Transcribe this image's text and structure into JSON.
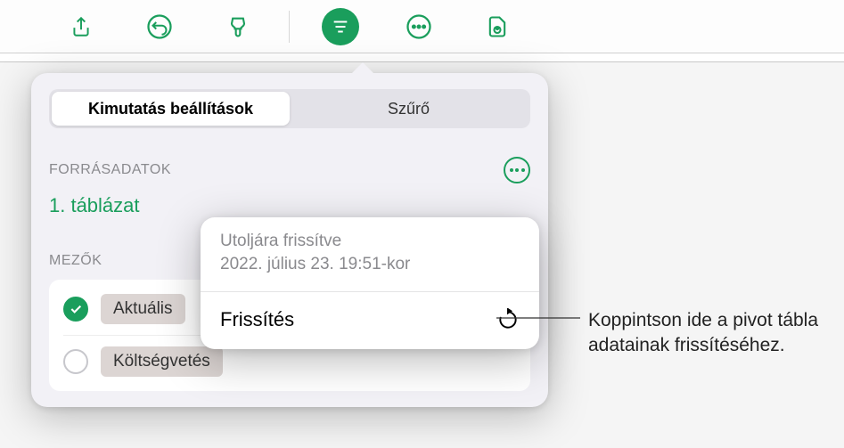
{
  "toolbar": {
    "icons": [
      "share-icon",
      "undo-icon",
      "format-brush-icon",
      "organize-icon",
      "more-icon",
      "collaborate-icon"
    ]
  },
  "popover": {
    "tabs": [
      {
        "label": "Kimutatás beállítások",
        "active": true
      },
      {
        "label": "Szűrő",
        "active": false
      }
    ],
    "sourceSection": {
      "heading": "FORRÁSADATOK",
      "link": "1. táblázat"
    },
    "fieldsSection": {
      "heading": "MEZŐK",
      "items": [
        {
          "label": "Aktuális",
          "checked": true
        },
        {
          "label": "Költségvetés",
          "checked": false
        }
      ]
    }
  },
  "refreshPopover": {
    "lastUpdatedLabel": "Utoljára frissítve",
    "lastUpdatedValue": "2022. július 23. 19:51-kor",
    "refreshLabel": "Frissítés"
  },
  "callout": {
    "text": "Koppintson ide a pivot tábla adatainak frissítéséhez."
  }
}
